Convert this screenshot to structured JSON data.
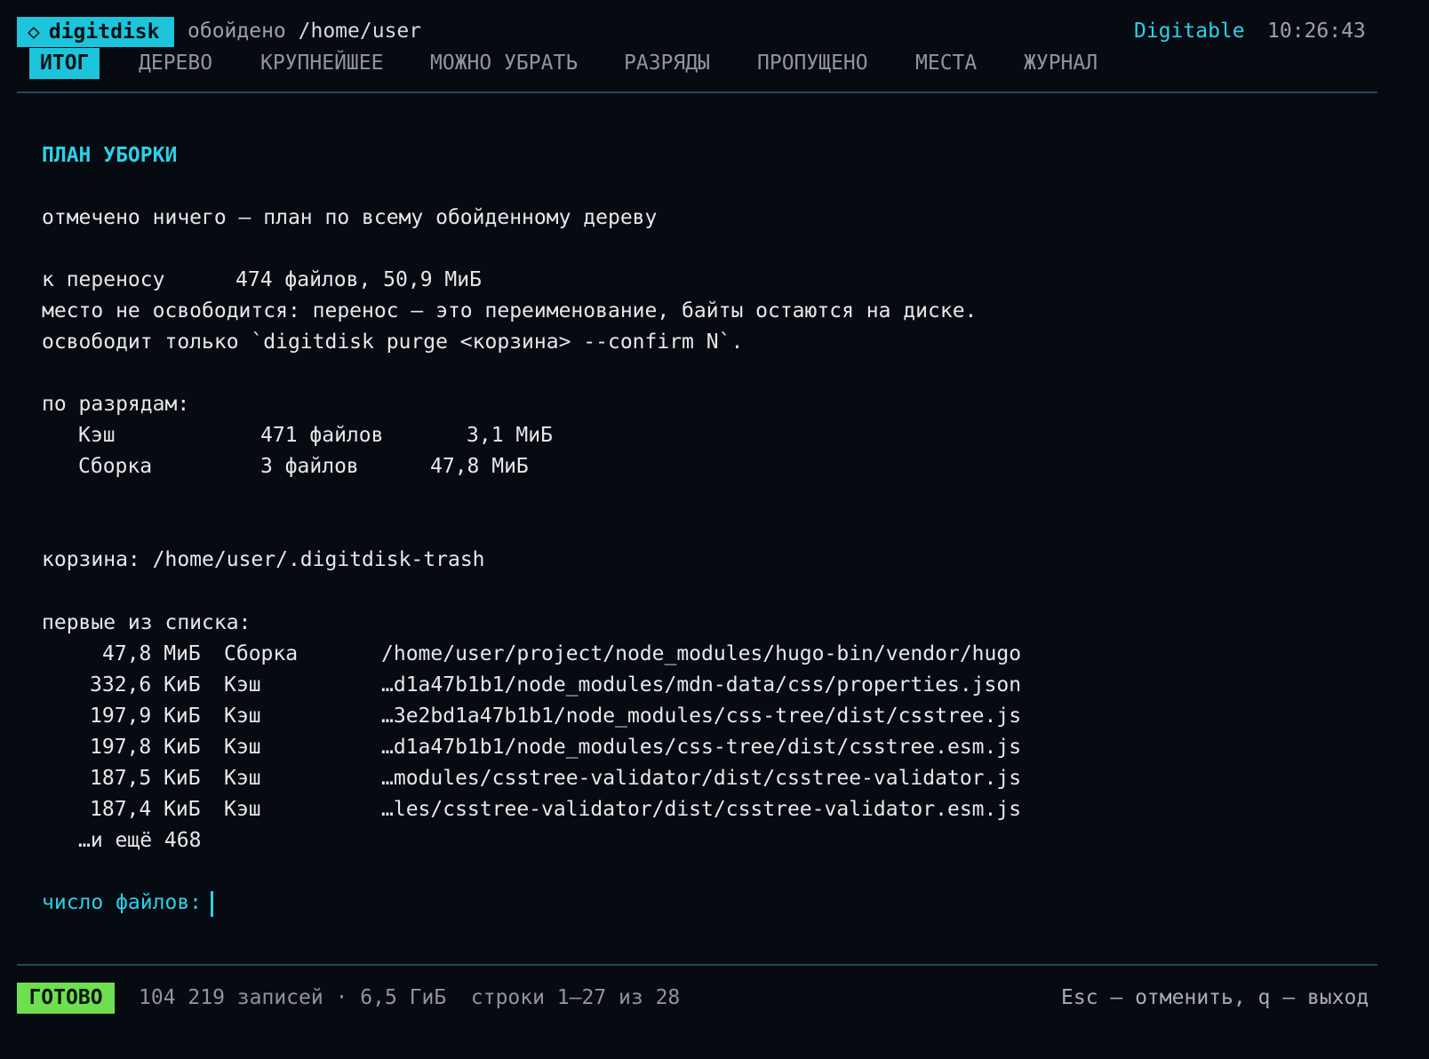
{
  "header": {
    "app_icon": "diamond-icon",
    "app_name": "digitdisk",
    "crumb_label": "обойдено",
    "crumb_path": "/home/user",
    "brand": "Digitable",
    "clock": "10:26:43"
  },
  "tabs": [
    {
      "label": "ИТОГ",
      "active": true
    },
    {
      "label": "ДЕРЕВО"
    },
    {
      "label": "КРУПНЕЙШЕЕ"
    },
    {
      "label": "МОЖНО УБРАТЬ"
    },
    {
      "label": "РАЗРЯДЫ"
    },
    {
      "label": "ПРОПУЩЕНО"
    },
    {
      "label": "МЕСТА"
    },
    {
      "label": "ЖУРНАЛ"
    }
  ],
  "plan": {
    "title": "ПЛАН УБОРКИ",
    "scope_note": "отмечено ничего — план по всему обойденному дереву",
    "move_label": "к переносу",
    "move_value": "474 файлов, 50,9 МиБ",
    "warning_1": "место не освободится: перенос — это переименование, байты остаются на диске.",
    "warning_2": "освободит только `digitdisk purge <корзина> --confirm N`.",
    "by_category_label": "по разрядам:",
    "categories": [
      {
        "name": "Кэш",
        "files": "471 файлов",
        "size": "3,1 МиБ"
      },
      {
        "name": "Сборка",
        "files": "3 файлов",
        "size": "47,8 МиБ"
      }
    ],
    "trash_label": "корзина:",
    "trash_path": "/home/user/.digitdisk-trash",
    "first_label": "первые из списка:",
    "items": [
      {
        "size": "47,8 МиБ",
        "category": "Сборка",
        "path": "/home/user/project/node_modules/hugo-bin/vendor/hugo"
      },
      {
        "size": "332,6 КиБ",
        "category": "Кэш",
        "path": "…d1a47b1b1/node_modules/mdn-data/css/properties.json"
      },
      {
        "size": "197,9 КиБ",
        "category": "Кэш",
        "path": "…3e2bd1a47b1b1/node_modules/css-tree/dist/csstree.js"
      },
      {
        "size": "197,8 КиБ",
        "category": "Кэш",
        "path": "…d1a47b1b1/node_modules/css-tree/dist/csstree.esm.js"
      },
      {
        "size": "187,5 КиБ",
        "category": "Кэш",
        "path": "…modules/csstree-validator/dist/csstree-validator.js"
      },
      {
        "size": "187,4 КиБ",
        "category": "Кэш",
        "path": "…les/csstree-validator/dist/csstree-validator.esm.js"
      }
    ],
    "more_note": "…и ещё 468",
    "prompt_label": "число файлов:",
    "prompt_value": ""
  },
  "footer": {
    "status": "ГОТОВО",
    "info": "104 219 записей · 6,5 ГиБ  строки 1–27 из 28",
    "hint": "Esc — отменить, q — выход"
  },
  "colors": {
    "background": "#060a11",
    "accent": "#1cc4dc",
    "ready": "#6ee04f"
  }
}
